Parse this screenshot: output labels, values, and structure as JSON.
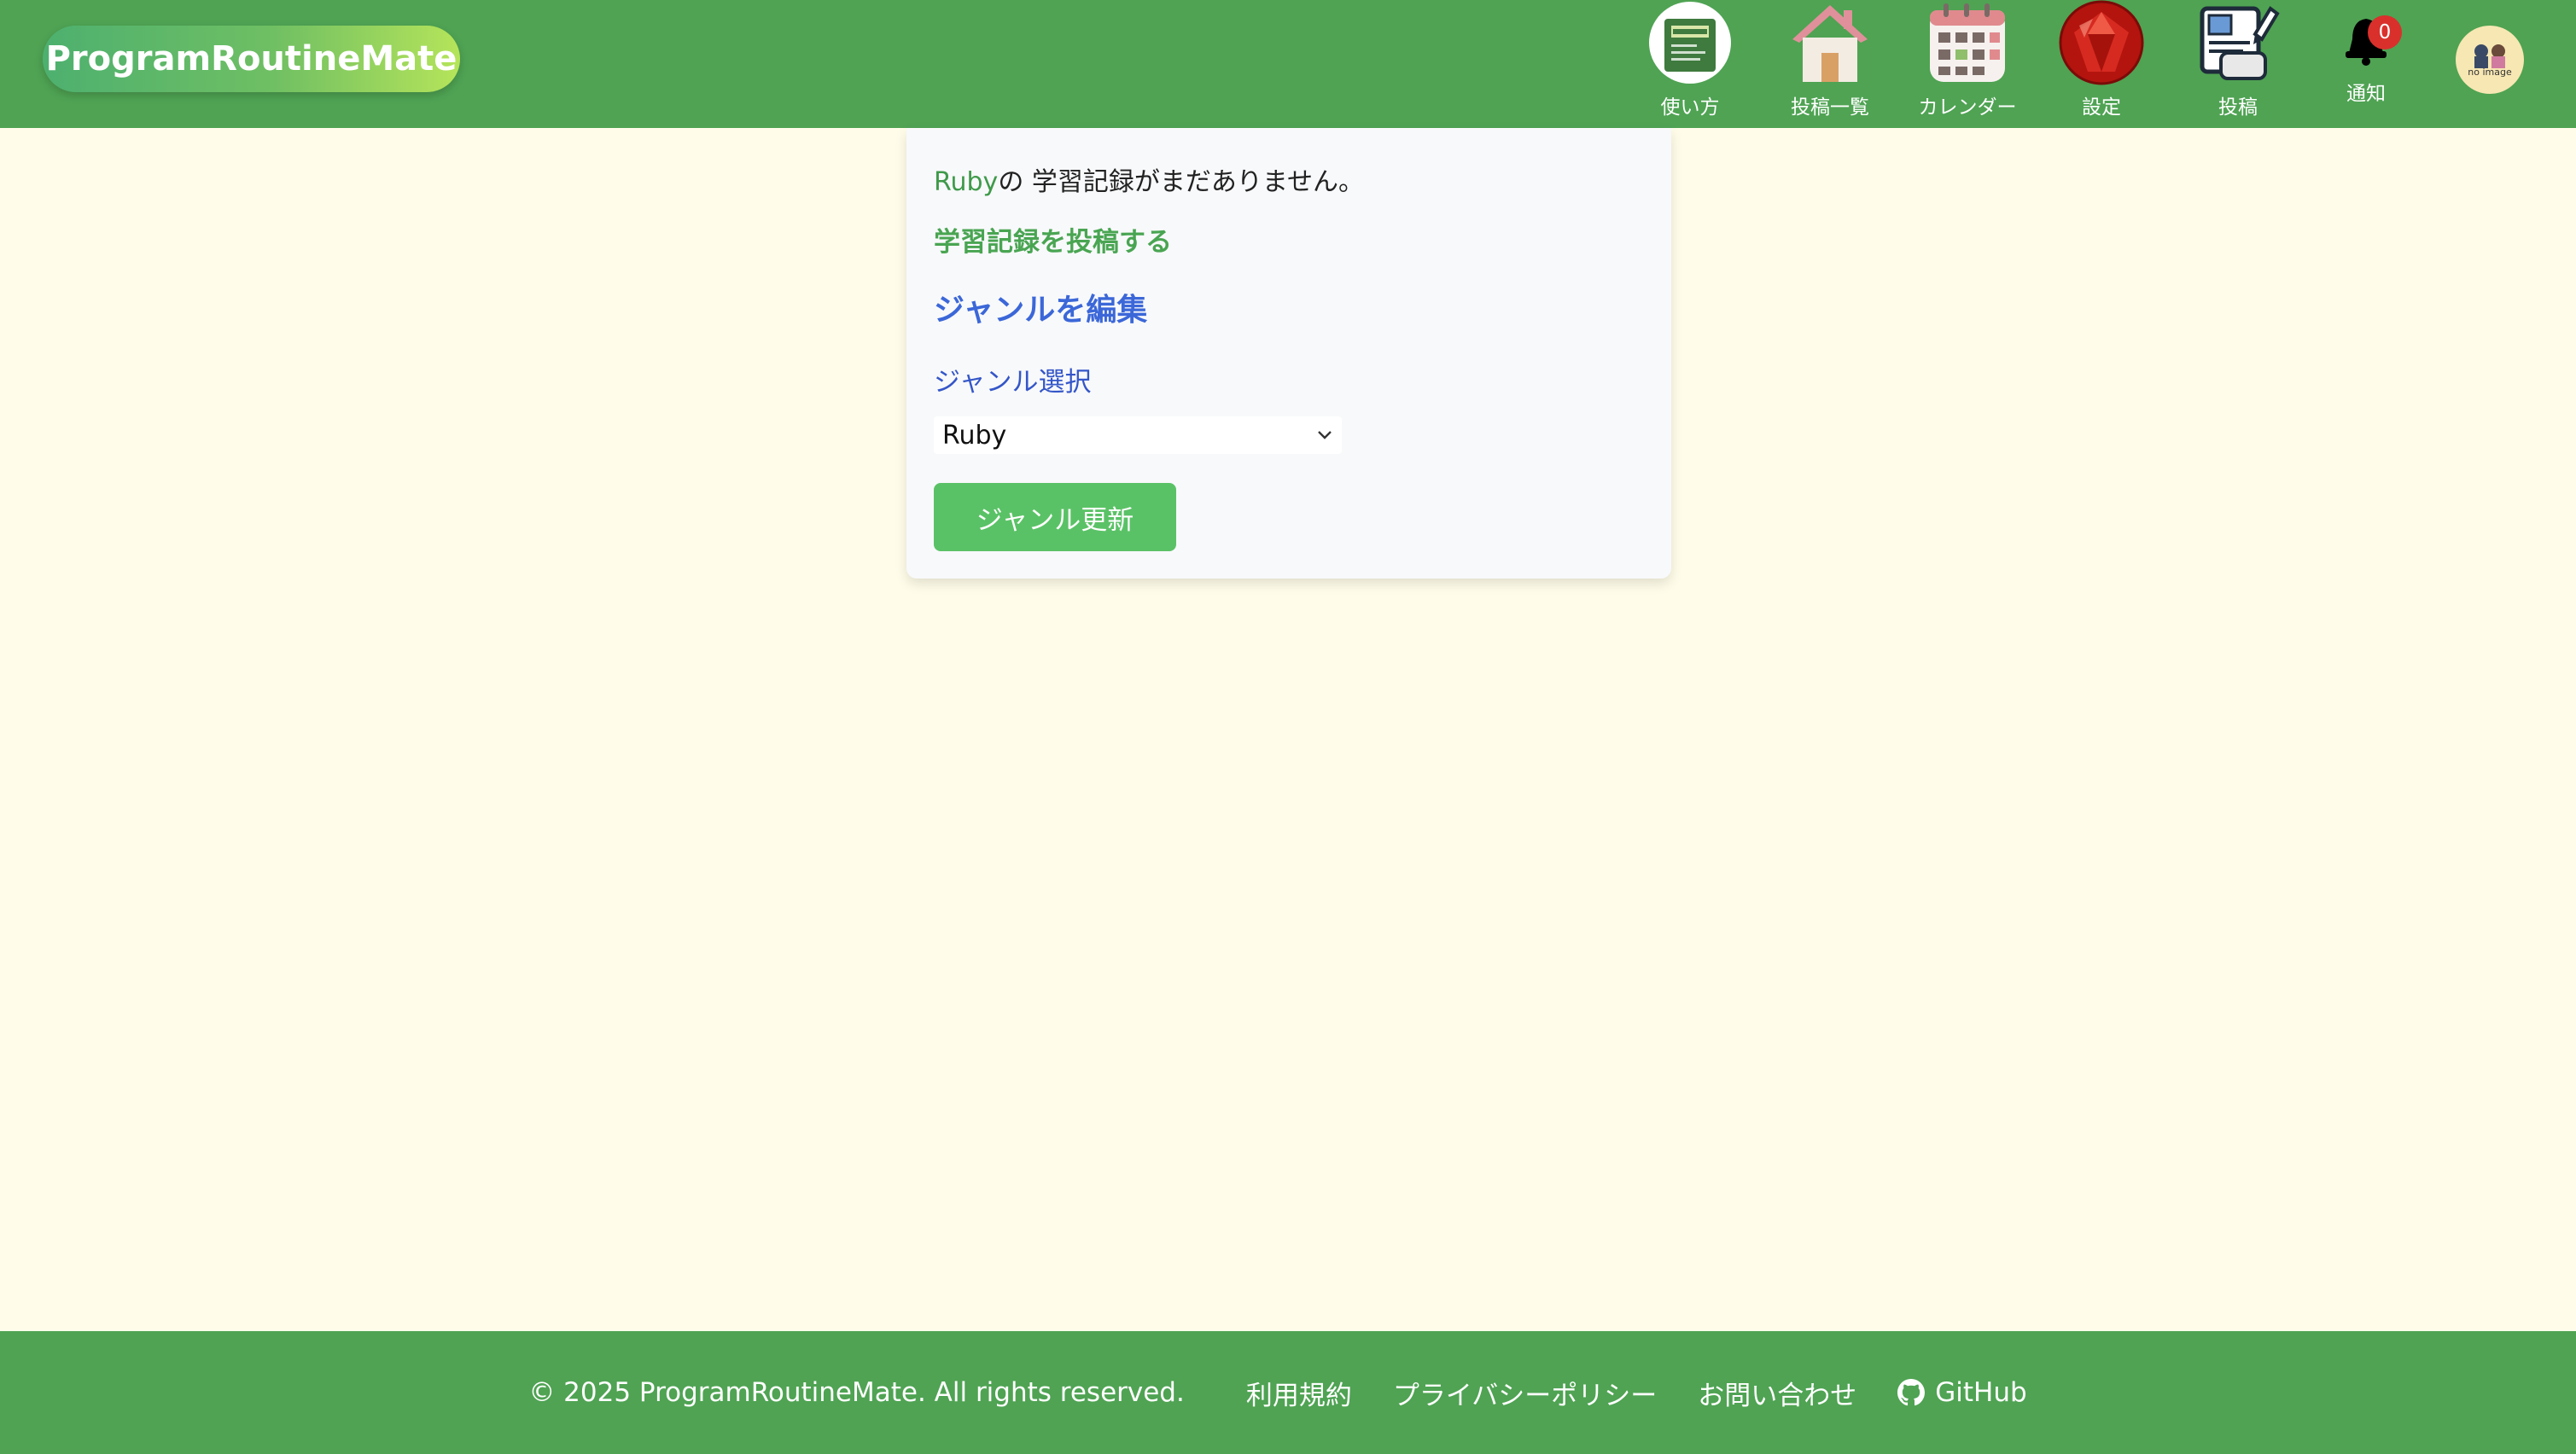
{
  "header": {
    "brand": "ProgramRoutineMate",
    "nav": {
      "howto": "使い方",
      "posts": "投稿一覧",
      "calendar": "カレンダー",
      "settings": "設定",
      "post": "投稿",
      "notifications": "通知",
      "notification_count": "0"
    },
    "avatar_text": "no image"
  },
  "main": {
    "genre_name": "Ruby",
    "empty_message_suffix": "の 学習記録がまだありません。",
    "post_link": "学習記録を投稿する",
    "edit_title": "ジャンルを編集",
    "select_label": "ジャンル選択",
    "selected_genre": "Ruby",
    "update_button": "ジャンル更新"
  },
  "footer": {
    "copyright": "© 2025 ProgramRoutineMate. All rights reserved.",
    "terms": "利用規約",
    "privacy": "プライバシーポリシー",
    "contact": "お問い合わせ",
    "github": "GitHub"
  },
  "colors": {
    "header_bg": "#4fa353",
    "page_bg": "#fffde9",
    "accent_green": "#5ac266",
    "link_blue": "#3b67d8",
    "badge_red": "#d9302c"
  }
}
